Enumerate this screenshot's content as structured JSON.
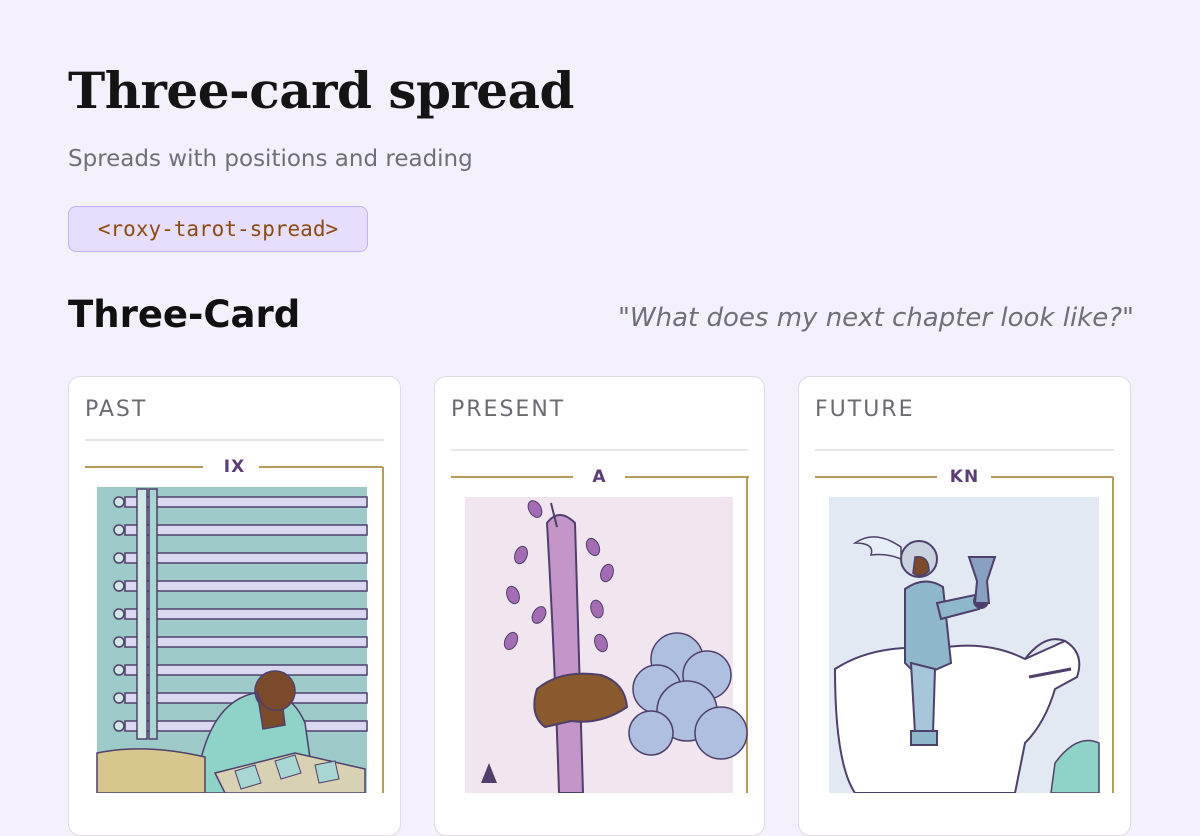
{
  "header": {
    "title": "Three-card spread",
    "subtitle": "Spreads with positions and reading",
    "tag": "<roxy-tarot-spread>"
  },
  "spread": {
    "name": "Three-Card",
    "question": "\"What does my next chapter look like?\"",
    "cards": [
      {
        "position": "PAST",
        "rank": "IX",
        "icon": "nine-of-swords-illustration"
      },
      {
        "position": "PRESENT",
        "rank": "A",
        "icon": "ace-of-wands-illustration"
      },
      {
        "position": "FUTURE",
        "rank": "KN",
        "icon": "knight-of-cups-illustration"
      }
    ]
  },
  "colors": {
    "page_bg": "#f4f1fc",
    "tag_bg": "#e6defc",
    "tag_text": "#8b4a12",
    "frame_gold": "#b89a5a",
    "rank_purple": "#5b3d7a"
  }
}
